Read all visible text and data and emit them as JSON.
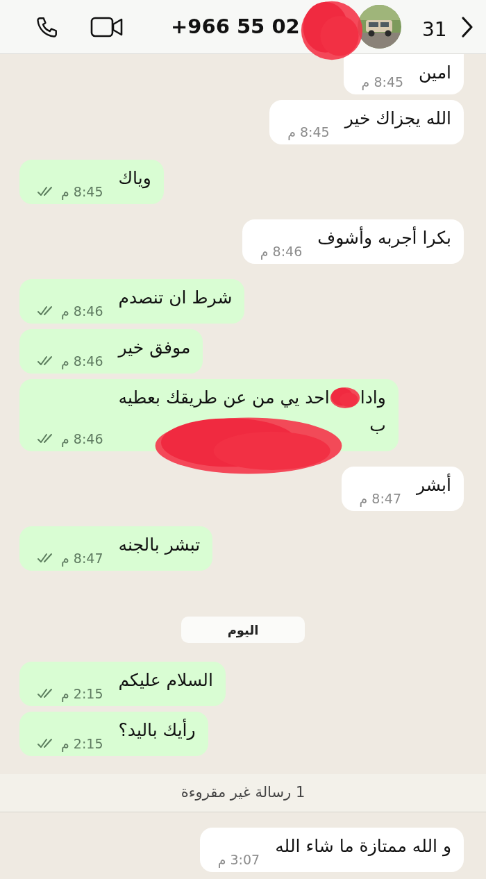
{
  "header": {
    "back_count": "31",
    "contact": "+966 55 02",
    "redacted": true
  },
  "messages": [
    {
      "kind": "incoming",
      "text": "امين",
      "time": "8:45 م",
      "clipped": true
    },
    {
      "kind": "incoming",
      "text": "الله يجزاك خير",
      "time": "8:45 م"
    },
    {
      "kind": "outgoing",
      "text": "وياك",
      "time": "8:45 م"
    },
    {
      "kind": "incoming",
      "text": "بكرا أجربه وأشوف",
      "time": "8:46 م"
    },
    {
      "kind": "outgoing",
      "text": "شرط ان تنصدم",
      "time": "8:46 م"
    },
    {
      "kind": "outgoing",
      "text": "موفق خير",
      "time": "8:46 م"
    },
    {
      "kind": "outgoing",
      "redacted": true,
      "fragments": [
        "وادا",
        "احد يي من عن طريقك بعطيه",
        "ب"
      ],
      "time": "8:46 م"
    },
    {
      "kind": "incoming",
      "text": "أبشر",
      "time": "8:47 م"
    },
    {
      "kind": "outgoing",
      "text": "تبشر بالجنه",
      "time": "8:47 م"
    },
    {
      "kind": "date",
      "text": "اليوم"
    },
    {
      "kind": "outgoing",
      "text": "السلام عليكم",
      "time": "2:15 م"
    },
    {
      "kind": "outgoing",
      "text": "رأيك باليد؟",
      "time": "2:15 م"
    },
    {
      "kind": "unread",
      "text": "1 رسالة غير مقروءة"
    },
    {
      "kind": "incoming",
      "text": "و الله ممتازة ما شاء الله",
      "time": "3:07 م"
    }
  ]
}
